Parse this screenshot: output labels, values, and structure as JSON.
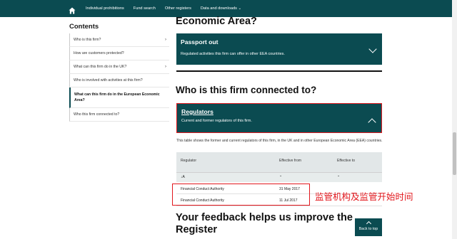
{
  "nav": {
    "items": [
      "Individual prohibitions",
      "Fund search",
      "Other registers",
      "Data and downloads"
    ],
    "data_downloads_caret": "⌄"
  },
  "sidebar": {
    "title": "Contents",
    "items": [
      {
        "label": "Who is this firm?",
        "chevron": "›"
      },
      {
        "label": "How are customers protected?"
      },
      {
        "label": "What can this firm do in the UK?",
        "chevron": "›"
      },
      {
        "label": "Who is involved with activities at this firm?"
      },
      {
        "label": "What can this firm do in the European Economic Area?"
      },
      {
        "label": "Who this firm connected to?"
      }
    ]
  },
  "main": {
    "heading_eco": "Economic Area?",
    "passport": {
      "title": "Passport out",
      "subtitle": "Regulated activities this firm can offer in other EEA countries."
    },
    "heading_who": "Who is this firm connected to?",
    "regulators": {
      "title": "Regulators",
      "subtitle": "Current and former regulators of this firm."
    },
    "description": "This table shows the former and current regulators of this firm, in the UK and in other European Economic Area (EEA) countries.",
    "table": {
      "headers": [
        "Regulator",
        "Effective from",
        "Effective to"
      ],
      "filter": "↓A",
      "rows": [
        {
          "regulator": "Financial Conduct Authority",
          "from": "31 May 2017",
          "to": ""
        },
        {
          "regulator": "Financial Conduct Authority",
          "from": "11 Jul 2017",
          "to": ""
        }
      ]
    },
    "heading_feedback_1": "Your feedback helps us improve the",
    "heading_feedback_2": "Register"
  },
  "annotation": "监管机构及监管开始时间",
  "back_to_top": "Back to top",
  "colors": {
    "brand": "#0b4b51",
    "annotation": "#e2171d"
  }
}
